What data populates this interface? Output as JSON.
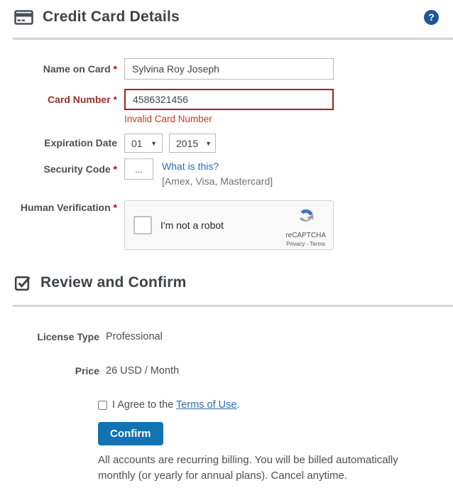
{
  "colors": {
    "accent_blue": "#1173b2",
    "link_blue": "#2a6db2",
    "help_icon_blue": "#1d5796",
    "error_dark_red": "#9c2421",
    "error_text_red": "#c43b23",
    "heading_slate": "#3e4348",
    "divider_gray": "#d4d4d4"
  },
  "card_section": {
    "title": "Credit Card Details",
    "fields": {
      "name_on_card": {
        "label": "Name on Card",
        "required_mark": "*",
        "value": "Sylvina Roy Joseph"
      },
      "card_number": {
        "label": "Card Number",
        "required_mark": "*",
        "value": "4586321456",
        "error": "Invalid Card Number"
      },
      "expiration": {
        "label": "Expiration Date",
        "month": "01",
        "year": "2015",
        "caret": "▼"
      },
      "security_code": {
        "label": "Security Code",
        "required_mark": "*",
        "value": "...",
        "help_link": "What is this?",
        "hint": "[Amex, Visa, Mastercard]"
      },
      "human_verification": {
        "label": "Human Verification",
        "required_mark": "*"
      }
    },
    "recaptcha": {
      "checkbox_label": "I'm not a robot",
      "brand": "reCAPTCHA",
      "privacy_terms": "Privacy - Terms"
    }
  },
  "review_section": {
    "title": "Review and Confirm",
    "rows": [
      {
        "label": "License Type",
        "value": "Professional"
      },
      {
        "label": "Price",
        "value": "26 USD / Month"
      }
    ],
    "agree": {
      "prefix": "I Agree to the",
      "link": "Terms of Use",
      "suffix": "."
    },
    "confirm_label": "Confirm",
    "note": "All accounts are recurring billing. You will be billed automatically monthly (or yearly for annual plans). Cancel anytime."
  }
}
